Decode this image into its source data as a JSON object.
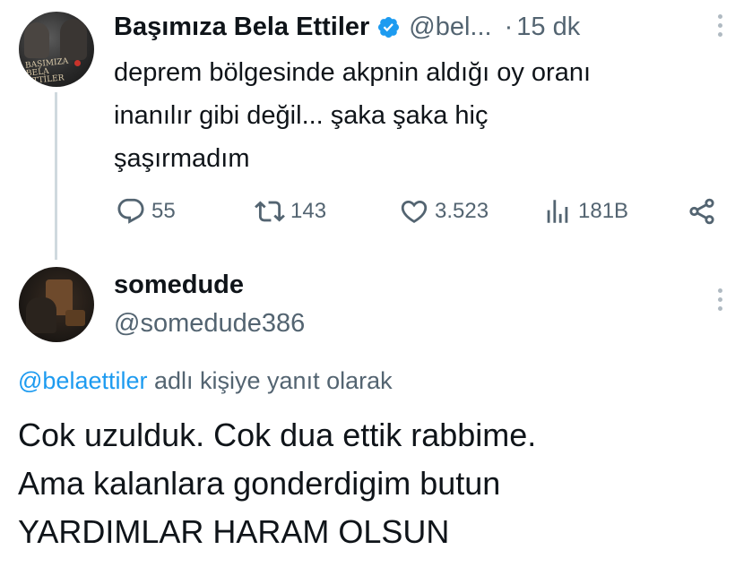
{
  "tweet": {
    "author_name": "Başımıza Bela Ettiler",
    "avatar_text": [
      "BAŞIMIZA",
      "BELA ETTİLER"
    ],
    "handle": "@bel...",
    "separator": "·",
    "time": "15 dk",
    "text_lines": [
      "deprem bölgesinde akpnin aldığı oy oranı",
      "inanılır gibi değil... şaka şaka hiç",
      "şaşırmadım"
    ],
    "actions": {
      "replies": "55",
      "retweets": "143",
      "likes": "3.523",
      "views": "181B"
    },
    "verified_color": "#1d9bf0"
  },
  "reply": {
    "author_name": "somedude",
    "handle": "@somedude386",
    "reply_to_mention": "@belaettiler",
    "reply_to_suffix": " adlı kişiye yanıt olarak",
    "text_lines": [
      "Cok uzulduk. Cok dua ettik rabbime.",
      "Ama kalanlara gonderdigim butun",
      "YARDIMLAR HARAM OLSUN"
    ]
  },
  "colors": {
    "text": "#0f1419",
    "secondary": "#536471",
    "link": "#1d9bf0"
  },
  "icons": [
    "reply-icon",
    "retweet-icon",
    "like-icon",
    "views-icon",
    "share-icon",
    "verified-icon",
    "more-icon"
  ]
}
